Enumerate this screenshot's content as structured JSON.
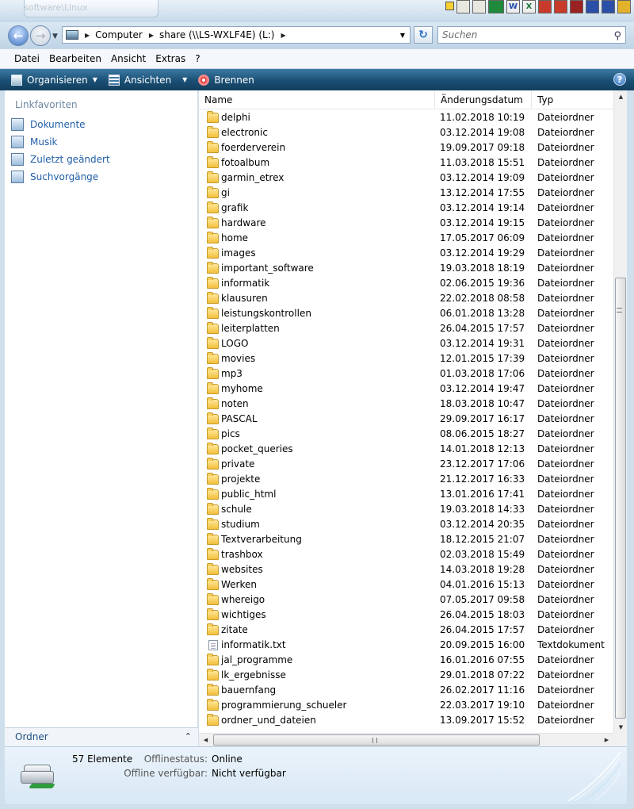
{
  "window": {
    "title_faded": "software\\Linux"
  },
  "address": {
    "crumbs": [
      "Computer",
      "share (\\\\LS-WXLF4E) (L:)"
    ]
  },
  "search": {
    "placeholder": "Suchen"
  },
  "menu": [
    "Datei",
    "Bearbeiten",
    "Ansicht",
    "Extras",
    "?"
  ],
  "toolbar": {
    "organize": "Organisieren",
    "views": "Ansichten",
    "burn": "Brennen"
  },
  "navpane": {
    "header": "Linkfavoriten",
    "items": [
      "Dokumente",
      "Musik",
      "Zuletzt geändert",
      "Suchvorgänge"
    ],
    "folders": "Ordner"
  },
  "columns": {
    "name": "Name",
    "date": "Änderungsdatum",
    "type": "Typ"
  },
  "files": [
    {
      "name": "delphi",
      "date": "11.02.2018 10:19",
      "type": "Dateiordner"
    },
    {
      "name": "electronic",
      "date": "03.12.2014 19:08",
      "type": "Dateiordner"
    },
    {
      "name": "foerderverein",
      "date": "19.09.2017 09:18",
      "type": "Dateiordner"
    },
    {
      "name": "fotoalbum",
      "date": "11.03.2018 15:51",
      "type": "Dateiordner"
    },
    {
      "name": "garmin_etrex",
      "date": "03.12.2014 19:09",
      "type": "Dateiordner"
    },
    {
      "name": "gi",
      "date": "13.12.2014 17:55",
      "type": "Dateiordner"
    },
    {
      "name": "grafik",
      "date": "03.12.2014 19:14",
      "type": "Dateiordner"
    },
    {
      "name": "hardware",
      "date": "03.12.2014 19:15",
      "type": "Dateiordner"
    },
    {
      "name": "home",
      "date": "17.05.2017 06:09",
      "type": "Dateiordner"
    },
    {
      "name": "images",
      "date": "03.12.2014 19:29",
      "type": "Dateiordner"
    },
    {
      "name": "important_software",
      "date": "19.03.2018 18:19",
      "type": "Dateiordner"
    },
    {
      "name": "informatik",
      "date": "02.06.2015 19:36",
      "type": "Dateiordner"
    },
    {
      "name": "klausuren",
      "date": "22.02.2018 08:58",
      "type": "Dateiordner"
    },
    {
      "name": "leistungskontrollen",
      "date": "06.01.2018 13:28",
      "type": "Dateiordner"
    },
    {
      "name": "leiterplatten",
      "date": "26.04.2015 17:57",
      "type": "Dateiordner"
    },
    {
      "name": "LOGO",
      "date": "03.12.2014 19:31",
      "type": "Dateiordner"
    },
    {
      "name": "movies",
      "date": "12.01.2015 17:39",
      "type": "Dateiordner"
    },
    {
      "name": "mp3",
      "date": "01.03.2018 17:06",
      "type": "Dateiordner"
    },
    {
      "name": "myhome",
      "date": "03.12.2014 19:47",
      "type": "Dateiordner"
    },
    {
      "name": "noten",
      "date": "18.03.2018 10:47",
      "type": "Dateiordner"
    },
    {
      "name": "PASCAL",
      "date": "29.09.2017 16:17",
      "type": "Dateiordner"
    },
    {
      "name": "pics",
      "date": "08.06.2015 18:27",
      "type": "Dateiordner"
    },
    {
      "name": "pocket_queries",
      "date": "14.01.2018 12:13",
      "type": "Dateiordner"
    },
    {
      "name": "private",
      "date": "23.12.2017 17:06",
      "type": "Dateiordner"
    },
    {
      "name": "projekte",
      "date": "21.12.2017 16:33",
      "type": "Dateiordner"
    },
    {
      "name": "public_html",
      "date": "13.01.2016 17:41",
      "type": "Dateiordner"
    },
    {
      "name": "schule",
      "date": "19.03.2018 14:33",
      "type": "Dateiordner"
    },
    {
      "name": "studium",
      "date": "03.12.2014 20:35",
      "type": "Dateiordner"
    },
    {
      "name": "Textverarbeitung",
      "date": "18.12.2015 21:07",
      "type": "Dateiordner"
    },
    {
      "name": "trashbox",
      "date": "02.03.2018 15:49",
      "type": "Dateiordner"
    },
    {
      "name": "websites",
      "date": "14.03.2018 19:28",
      "type": "Dateiordner"
    },
    {
      "name": "Werken",
      "date": "04.01.2016 15:13",
      "type": "Dateiordner"
    },
    {
      "name": "whereigo",
      "date": "07.05.2017 09:58",
      "type": "Dateiordner"
    },
    {
      "name": "wichtiges",
      "date": "26.04.2015 18:03",
      "type": "Dateiordner"
    },
    {
      "name": "zitate",
      "date": "26.04.2015 17:57",
      "type": "Dateiordner"
    },
    {
      "name": "informatik.txt",
      "date": "20.09.2015 16:00",
      "type": "Textdokument",
      "icon": "text-file-icon"
    },
    {
      "name": "jal_programme",
      "date": "16.01.2016 07:55",
      "type": "Dateiordner"
    },
    {
      "name": "lk_ergebnisse",
      "date": "29.01.2018 07:22",
      "type": "Dateiordner"
    },
    {
      "name": "bauernfang",
      "date": "26.02.2017 11:16",
      "type": "Dateiordner"
    },
    {
      "name": "programmierung_schueler",
      "date": "22.03.2017 19:10",
      "type": "Dateiordner"
    },
    {
      "name": "ordner_und_dateien",
      "date": "13.09.2017 15:52",
      "type": "Dateiordner"
    }
  ],
  "details": {
    "count": "57 Elemente",
    "offline_status_label": "Offlinestatus:",
    "offline_status_value": "Online",
    "offline_avail_label": "Offline verfügbar:",
    "offline_avail_value": "Nicht verfügbar"
  },
  "tray_icons": [
    "W",
    "X"
  ]
}
